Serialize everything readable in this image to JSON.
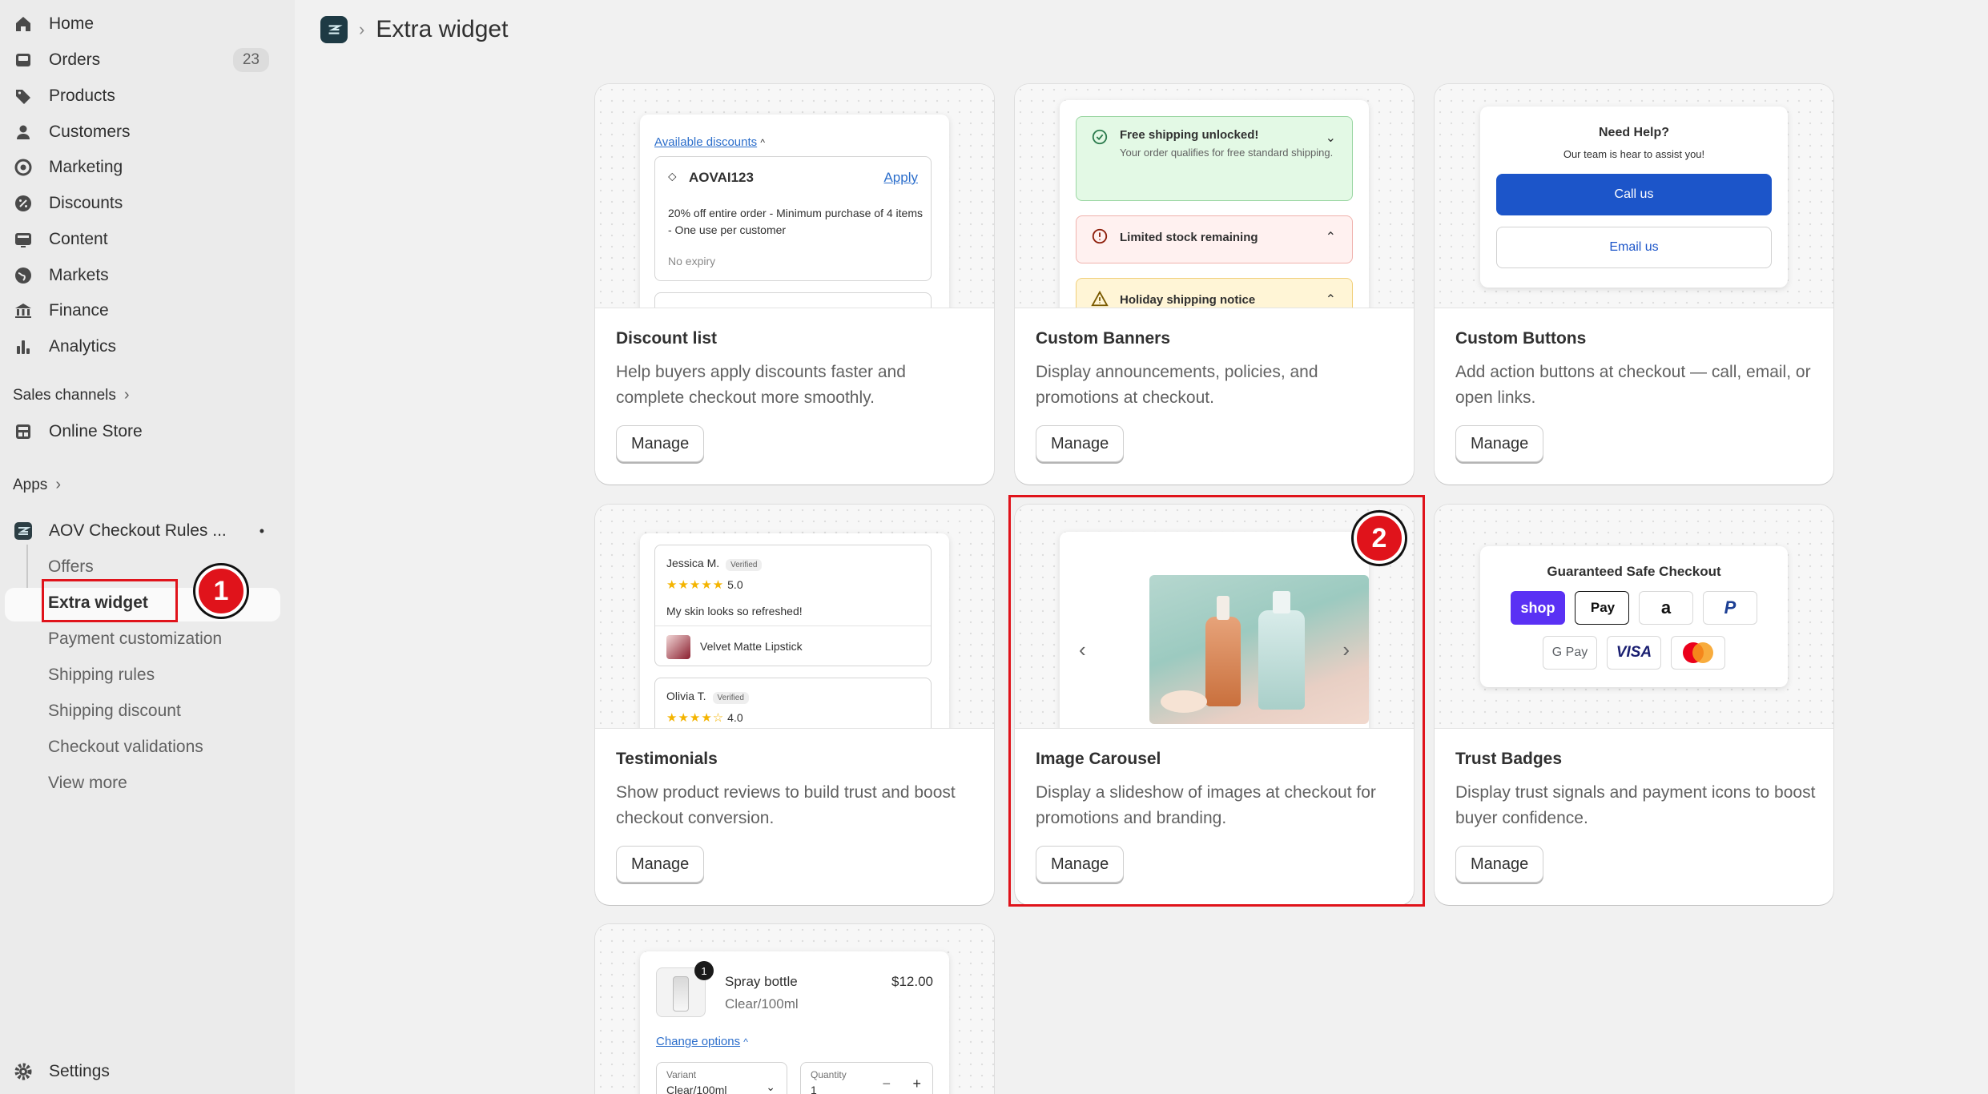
{
  "sidebar": {
    "nav": [
      {
        "label": "Home",
        "icon": "home-icon"
      },
      {
        "label": "Orders",
        "icon": "inbox-icon",
        "badge": "23"
      },
      {
        "label": "Products",
        "icon": "tag-icon"
      },
      {
        "label": "Customers",
        "icon": "person-icon"
      },
      {
        "label": "Marketing",
        "icon": "target-icon"
      },
      {
        "label": "Discounts",
        "icon": "discount-icon"
      },
      {
        "label": "Content",
        "icon": "content-icon"
      },
      {
        "label": "Markets",
        "icon": "globe-icon"
      },
      {
        "label": "Finance",
        "icon": "bank-icon"
      },
      {
        "label": "Analytics",
        "icon": "bar-chart-icon"
      }
    ],
    "sales_channels": "Sales channels",
    "online_store": "Online Store",
    "apps": "Apps",
    "app_name": "AOV Checkout Rules ...",
    "app_subitems": [
      "Offers",
      "Extra widget",
      "Payment customization",
      "Shipping rules",
      "Shipping discount",
      "Checkout validations",
      "View more"
    ],
    "settings": "Settings"
  },
  "annotations": {
    "marker_1": "1",
    "marker_2": "2"
  },
  "header": {
    "title": "Extra widget"
  },
  "cards": [
    {
      "title": "Discount list",
      "description": "Help buyers apply discounts faster and complete checkout more smoothly.",
      "button": "Manage",
      "preview": {
        "link": "Available discounts",
        "code": "AOVAI123",
        "apply": "Apply",
        "details": "20% off entire order - Minimum purchase of 4 items - One use per customer",
        "expiry": "No expiry"
      }
    },
    {
      "title": "Custom Banners",
      "description": "Display announcements, policies, and promotions at checkout.",
      "button": "Manage",
      "preview": {
        "banner1_title": "Free shipping unlocked!",
        "banner1_body": "Your order qualifies for free standard shipping.",
        "banner2_title": "Limited stock remaining",
        "banner3_title": "Holiday shipping notice"
      }
    },
    {
      "title": "Custom Buttons",
      "description": "Add action buttons at checkout — call, email, or open links.",
      "button": "Manage",
      "preview": {
        "heading": "Need Help?",
        "subheading": "Our team is hear to assist you!",
        "call": "Call us",
        "email": "Email us"
      }
    },
    {
      "title": "Testimonials",
      "description": "Show product reviews to build trust and boost checkout conversion.",
      "button": "Manage",
      "preview": {
        "r1_name": "Jessica M.",
        "verified": "Verified",
        "r1_rating": "5.0",
        "r1_text": "My skin looks so refreshed!",
        "r1_product": "Velvet Matte Lipstick",
        "r2_name": "Olivia T.",
        "r2_rating": "4.0"
      }
    },
    {
      "title": "Image Carousel",
      "description": "Display a slideshow of images at checkout for promotions and branding.",
      "button": "Manage"
    },
    {
      "title": "Trust Badges",
      "description": "Display trust signals and payment icons to boost buyer confidence.",
      "button": "Manage",
      "preview": {
        "heading": "Guaranteed Safe Checkout",
        "methods": [
          "shop",
          "Pay",
          "a",
          "P",
          "G Pay",
          "VISA",
          "mastercard"
        ]
      }
    },
    {
      "preview": {
        "product": "Spray bottle",
        "price": "$12.00",
        "variant_value": "Clear/100ml",
        "qty_badge": "1",
        "change": "Change options",
        "variant_label": "Variant",
        "variant_select": "Clear/100ml",
        "quantity_label": "Quantity",
        "quantity_value": "1"
      }
    }
  ],
  "colors": {
    "accent_red": "#e0131b",
    "primary_blue": "#1c55c9",
    "link_blue": "#2c6ecb"
  }
}
